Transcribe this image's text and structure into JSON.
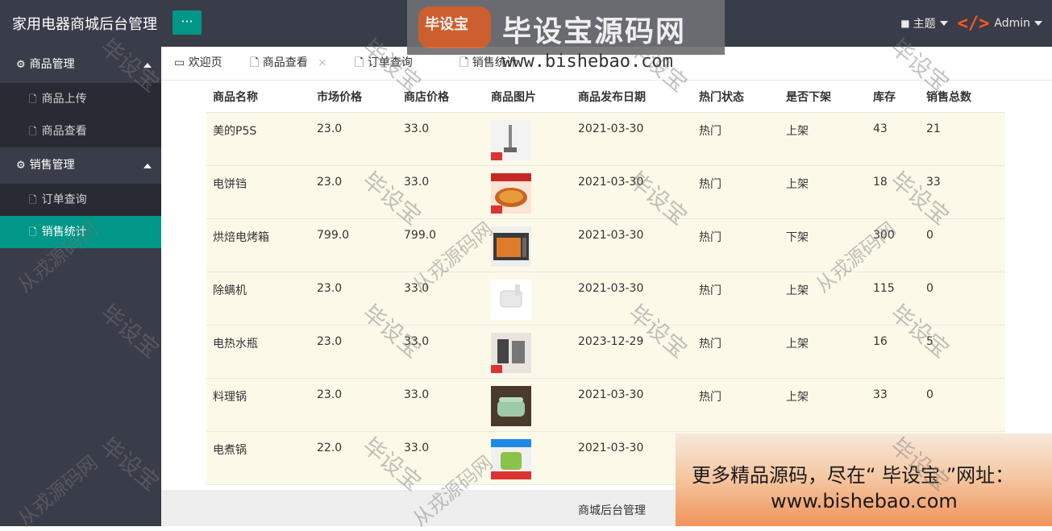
{
  "header": {
    "app_title": "家用电器商城后台管理",
    "toggle_label": "···",
    "theme_label": "主题",
    "admin_label": "Admin"
  },
  "sidebar": {
    "groups": [
      {
        "label": "商品管理",
        "items": [
          {
            "label": "商品上传"
          },
          {
            "label": "商品查看"
          }
        ]
      },
      {
        "label": "销售管理",
        "items": [
          {
            "label": "订单查询"
          },
          {
            "label": "销售统计",
            "active": true
          }
        ]
      }
    ]
  },
  "tabs": [
    {
      "label": "欢迎页"
    },
    {
      "label": "商品查看",
      "close": "×"
    },
    {
      "label": "订单查询"
    },
    {
      "label": "销售统计"
    }
  ],
  "table": {
    "headers": [
      "商品名称",
      "市场价格",
      "商店价格",
      "商品图片",
      "商品发布日期",
      "热门状态",
      "是否下架",
      "库存",
      "销售总数"
    ],
    "rows": [
      {
        "name": "美的P5S",
        "market": "23.0",
        "store": "33.0",
        "date": "2021-03-30",
        "hot": "热门",
        "shelf": "上架",
        "stock": "43",
        "sales": "21"
      },
      {
        "name": "电饼铛",
        "market": "23.0",
        "store": "33.0",
        "date": "2021-03-30",
        "hot": "热门",
        "shelf": "上架",
        "stock": "18",
        "sales": "33"
      },
      {
        "name": "烘焙电烤箱",
        "market": "799.0",
        "store": "799.0",
        "date": "2021-03-30",
        "hot": "热门",
        "shelf": "下架",
        "stock": "300",
        "sales": "0"
      },
      {
        "name": "除螨机",
        "market": "23.0",
        "store": "33.0",
        "date": "2021-03-30",
        "hot": "热门",
        "shelf": "上架",
        "stock": "115",
        "sales": "0"
      },
      {
        "name": "电热水瓶",
        "market": "23.0",
        "store": "33.0",
        "date": "2023-12-29",
        "hot": "热门",
        "shelf": "上架",
        "stock": "16",
        "sales": "5"
      },
      {
        "name": "料理锅",
        "market": "23.0",
        "store": "33.0",
        "date": "2021-03-30",
        "hot": "热门",
        "shelf": "上架",
        "stock": "33",
        "sales": "0"
      },
      {
        "name": "电煮锅",
        "market": "22.0",
        "store": "33.0",
        "date": "2021-03-30",
        "hot": "",
        "shelf": "",
        "stock": "",
        "sales": ""
      }
    ]
  },
  "footer": {
    "text": "商城后台管理"
  },
  "banner": {
    "logo_text": "毕设宝",
    "title": "毕设宝源码网",
    "url": "www.bishebao.com"
  },
  "ad": {
    "line1": "更多精品源码，尽在“ 毕设宝 ”网址：",
    "line2": "www.bishebao.com"
  },
  "watermarks": {
    "a": "毕设宝",
    "b": "从戎源码网"
  },
  "colors": {
    "header_bg": "#393d49",
    "accent": "#009688",
    "row_bg": "#fdf9e9"
  }
}
